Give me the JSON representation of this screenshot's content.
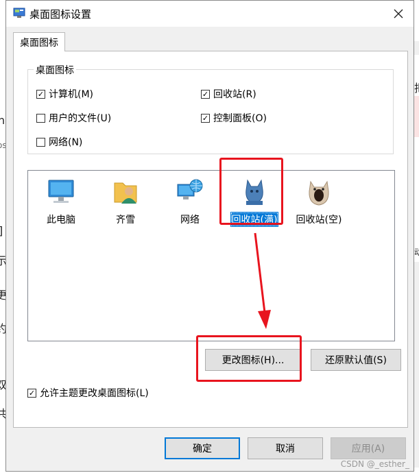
{
  "window": {
    "title": "桌面图标设置"
  },
  "tabs": [
    {
      "label": "桌面图标"
    }
  ],
  "group": {
    "label": "桌面图标",
    "checkboxes": [
      {
        "label": "计算机(M)",
        "checked": true
      },
      {
        "label": "回收站(R)",
        "checked": true
      },
      {
        "label": "用户的文件(U)",
        "checked": false
      },
      {
        "label": "控制面板(O)",
        "checked": true
      },
      {
        "label": "网络(N)",
        "checked": false
      }
    ]
  },
  "icons": [
    {
      "label": "此电脑",
      "icon": "monitor-icon"
    },
    {
      "label": "齐雪",
      "icon": "user-folder-icon"
    },
    {
      "label": "网络",
      "icon": "network-icon"
    },
    {
      "label": "回收站(满)",
      "icon": "cat-blue-icon",
      "selected": true
    },
    {
      "label": "回收站(空)",
      "icon": "cat-mouth-open-icon"
    }
  ],
  "buttons": {
    "change_icon": "更改图标(H)...",
    "restore_default": "还原默认值(S)",
    "ok": "确定",
    "cancel": "取消",
    "apply": "应用(A)"
  },
  "allow_theme": {
    "label": "允许主题更改桌面图标(L)",
    "checked": true
  },
  "background_fragments": [
    "n",
    "os",
    "]",
    "示",
    "更",
    "约",
    "双",
    "共",
    "把",
    "动"
  ],
  "watermark": "CSDN @_esther_",
  "colors": {
    "selection": "#0078d7",
    "annotation": "#e8141e"
  }
}
